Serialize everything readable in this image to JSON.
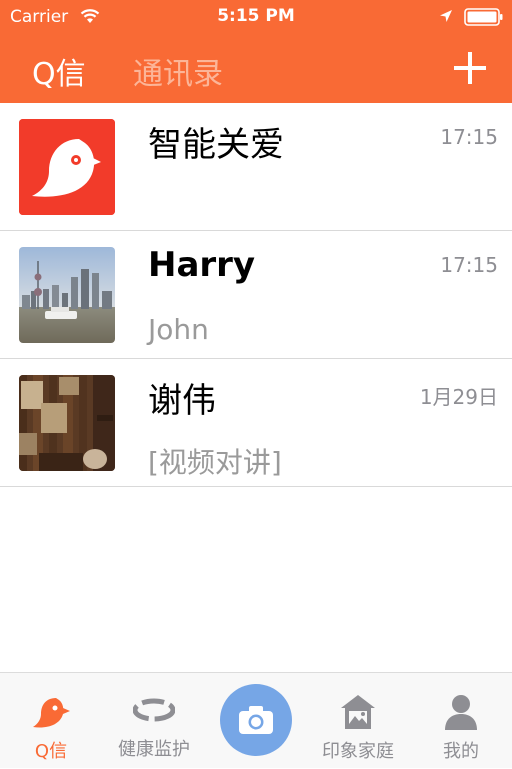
{
  "status_bar": {
    "carrier": "Carrier",
    "time": "5:15 PM"
  },
  "nav": {
    "tabs": [
      {
        "label": "Q信",
        "active": true
      },
      {
        "label": "通讯录",
        "active": false
      }
    ],
    "add_icon": "plus-icon"
  },
  "conversations": [
    {
      "name": "智能关爱",
      "time": "17:15",
      "preview": "",
      "avatar": "bird-logo-icon"
    },
    {
      "name": "Harry",
      "time": "17:15",
      "preview": "John",
      "avatar": "city-skyline-photo"
    },
    {
      "name": "谢伟",
      "time": "1月29日",
      "preview": "[视频对讲]",
      "avatar": "interior-wood-photo"
    }
  ],
  "tab_bar": {
    "items": [
      {
        "label": "Q信",
        "icon": "bird-icon",
        "active": true
      },
      {
        "label": "健康监护",
        "icon": "bracelet-icon",
        "active": false
      },
      {
        "label": "",
        "icon": "camera-icon",
        "active": false
      },
      {
        "label": "印象家庭",
        "icon": "home-photo-icon",
        "active": false
      },
      {
        "label": "我的",
        "icon": "person-icon",
        "active": false
      }
    ]
  },
  "colors": {
    "accent": "#F96A35",
    "tab_inactive": "#FCB598",
    "camera_button": "#76A6E6",
    "secondary_text": "#8E8E93"
  }
}
